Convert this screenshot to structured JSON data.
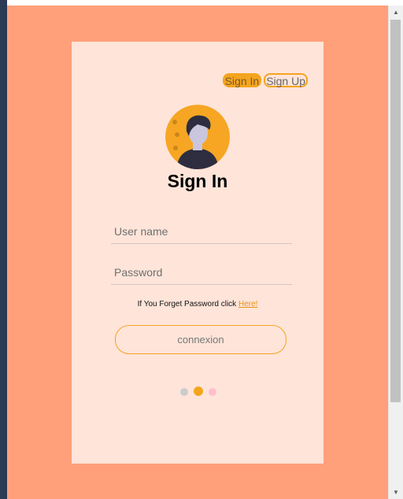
{
  "toggle": {
    "signin_label": "Sign In",
    "signup_label": "Sign Up"
  },
  "form": {
    "title": "Sign In",
    "username_placeholder": "User name",
    "password_placeholder": "Password",
    "forgot_text": "If You Forget Password click ",
    "forgot_link": "Here!",
    "submit_label": "connexion"
  },
  "dots": [
    {
      "color": "#cccccc",
      "active": false
    },
    {
      "color": "#f4a51f",
      "active": true
    },
    {
      "color": "#ffc0cb",
      "active": false
    }
  ],
  "colors": {
    "page_bg": "#ffa07a",
    "card_bg": "#ffe4d9",
    "accent": "#f4a51f"
  },
  "icons": {
    "avatar": "user-avatar-icon",
    "scroll_up": "scroll-up-arrow-icon",
    "scroll_down": "scroll-down-arrow-icon"
  }
}
